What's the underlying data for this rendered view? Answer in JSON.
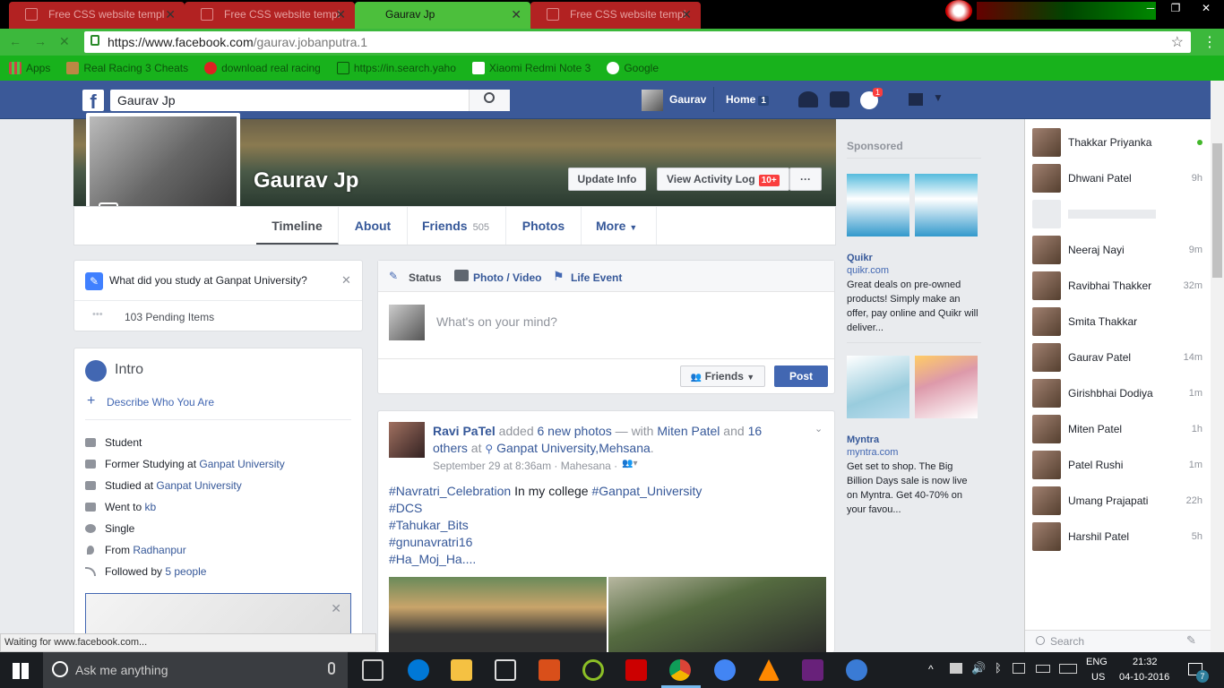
{
  "browser": {
    "tabs": [
      {
        "title": "Free CSS website templ",
        "active": false
      },
      {
        "title": "Free CSS website templ",
        "active": false
      },
      {
        "title": "Gaurav Jp",
        "active": true
      },
      {
        "title": "Free CSS website templ",
        "active": false
      }
    ],
    "url_host": "https://www.facebook.com",
    "url_path": "/gaurav.jobanputra.1",
    "bookmarks": [
      "Apps",
      "Real Racing 3 Cheats",
      "download real racing",
      "https://in.search.yaho",
      "Xiaomi Redmi Note 3",
      "Google"
    ],
    "status": "Waiting for www.facebook.com..."
  },
  "fb": {
    "search_value": "Gaurav Jp",
    "user": "Gaurav",
    "home": "Home",
    "home_count": "1",
    "notif_count": "1"
  },
  "profile": {
    "name": "Gaurav Jp",
    "update_info": "Update Info",
    "activity_log": "View Activity Log",
    "activity_badge": "10+",
    "more_dots": "···",
    "tabs": {
      "timeline": "Timeline",
      "about": "About",
      "friends": "Friends",
      "friends_count": "505",
      "photos": "Photos",
      "more": "More"
    }
  },
  "prompt": {
    "question": "What did you study at Ganpat University?",
    "pending": "103 Pending Items"
  },
  "intro": {
    "title": "Intro",
    "describe": "Describe Who You Are",
    "rows": [
      {
        "pre": "Student",
        "link": ""
      },
      {
        "pre": "Former Studying at ",
        "link": "Ganpat University"
      },
      {
        "pre": "Studied at ",
        "link": "Ganpat University"
      },
      {
        "pre": "Went to ",
        "link": "kb"
      },
      {
        "pre": "Single",
        "link": ""
      },
      {
        "pre": "From ",
        "link": "Radhanpur"
      },
      {
        "pre": "Followed by ",
        "link": "5 people"
      }
    ]
  },
  "composer": {
    "status": "Status",
    "photo": "Photo / Video",
    "life": "Life Event",
    "placeholder": "What's on your mind?",
    "audience": "Friends",
    "post": "Post"
  },
  "post": {
    "author": "Ravi PaTel",
    "action": " added ",
    "photos": "6 new photos",
    "with": " — with ",
    "tagged": "Miten Patel",
    "and": " and ",
    "others_a": "16",
    "others_b": "others",
    "at": " at ",
    "place": "Ganpat University,Mehsana",
    "dot": ".",
    "meta": "September 29 at 8:36am · Mahesana ·",
    "tag1": "#Navratri_Celebration",
    "text1": " In my college ",
    "tag2": "#Ganpat_University",
    "tag3": "#DCS",
    "tag4": "#Tahukar_Bits",
    "tag5": "#gnunavratri16",
    "tag6": "#Ha_Moj_Ha...."
  },
  "ads": {
    "sponsored": "Sponsored",
    "ad1": {
      "name": "Quikr",
      "url": "quikr.com",
      "text": "Great deals on pre-owned products! Simply make an offer, pay online and Quikr will deliver..."
    },
    "ad2": {
      "name": "Myntra",
      "url": "myntra.com",
      "text": "Get set to shop. The Big Billion Days sale is now live on Myntra. Get 40-70% on your favou..."
    }
  },
  "chat": {
    "contacts": [
      {
        "name": "Thakkar Priyanka",
        "time": ""
      },
      {
        "name": "Dhwani Patel",
        "time": "9h"
      },
      {
        "name": "",
        "time": ""
      },
      {
        "name": "Neeraj Nayi",
        "time": "9m"
      },
      {
        "name": "Ravibhai Thakker",
        "time": "32m"
      },
      {
        "name": "Smita Thakkar",
        "time": ""
      },
      {
        "name": "Gaurav Patel",
        "time": "14m"
      },
      {
        "name": "Girishbhai Dodiya",
        "time": "1m"
      },
      {
        "name": "Miten Patel",
        "time": "1h"
      },
      {
        "name": "Patel Rushi",
        "time": "1m"
      },
      {
        "name": "Umang Prajapati",
        "time": "22h"
      },
      {
        "name": "Harshil Patel",
        "time": "5h"
      }
    ],
    "search_placeholder": "Search"
  },
  "taskbar": {
    "search": "Ask me anything",
    "lang1": "ENG",
    "lang2": "US",
    "time": "21:32",
    "date": "04-10-2016",
    "notif": "7"
  }
}
